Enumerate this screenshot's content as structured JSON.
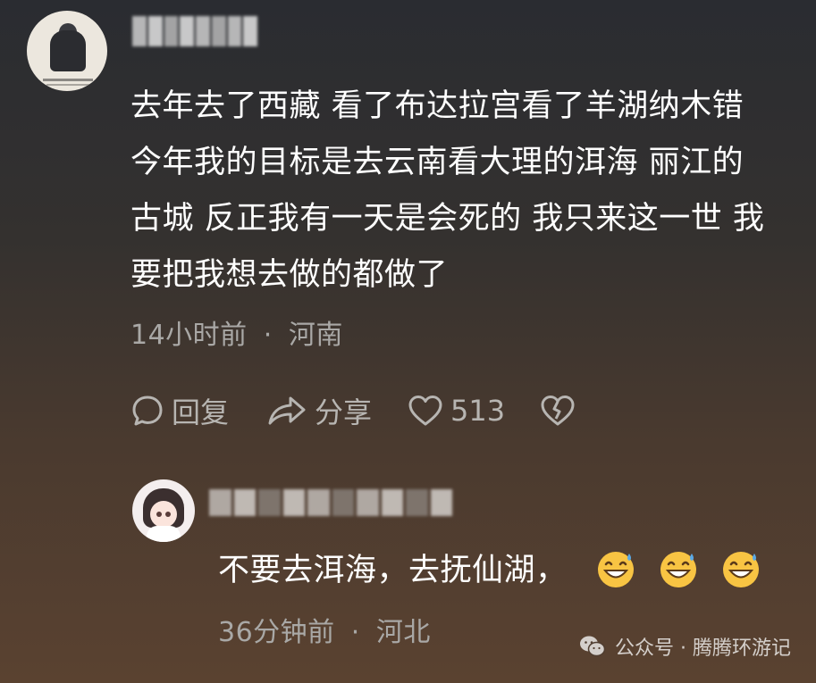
{
  "main_comment": {
    "avatar": "user-avatar",
    "text": "去年去了西藏 看了布达拉宫看了羊湖纳木错\n今年我的目标是去云南看大理的洱海 丽江的\n古城 反正我有一天是会死的 我只来这一世 我\n要把我想去做的都做了",
    "time": "14小时前",
    "separator": "·",
    "location": "河南"
  },
  "actions": {
    "reply_icon": "comment-bubble-icon",
    "reply_label": "回复",
    "share_icon": "share-arrow-icon",
    "share_label": "分享",
    "like_icon": "heart-outline-icon",
    "like_count": "513",
    "dislike_icon": "broken-heart-icon"
  },
  "reply": {
    "avatar": "anime-girl-avatar",
    "text": "不要去洱海，去抚仙湖，",
    "emojis": [
      "grinning-sweat-emoji",
      "grinning-sweat-emoji",
      "grinning-sweat-emoji"
    ],
    "time": "36分钟前",
    "separator": "·",
    "location": "河北"
  },
  "watermark": {
    "icon": "wechat-icon",
    "text": "公众号 · 腾腾环游记"
  },
  "colors": {
    "text_primary": "#ffffff",
    "text_secondary": "#a9a8a6",
    "action_gray": "#b7b5b2",
    "emoji_yellow": "#f8c443",
    "sweat_blue": "#5aa9e6"
  }
}
